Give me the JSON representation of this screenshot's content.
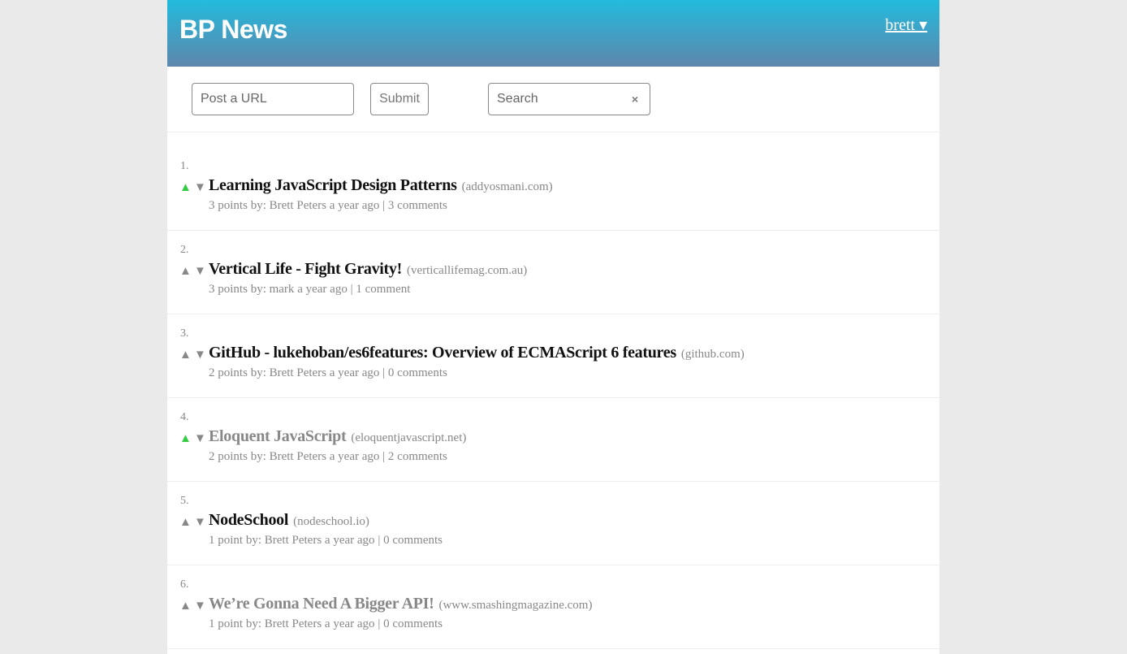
{
  "header": {
    "logo": "BP News",
    "user_label": "brett ▾"
  },
  "toolbar": {
    "url_placeholder": "Post a URL",
    "submit_label": "Submit",
    "search_placeholder": "Search",
    "clear_label": "×"
  },
  "vote_icons": {
    "up": "▲",
    "down": "▼"
  },
  "colors": {
    "header_top": "#22bbdd",
    "header_bottom": "#5e86ac",
    "upvote_active": "#33cc44",
    "muted": "#888888"
  },
  "items": [
    {
      "rank": "1.",
      "title": "Learning JavaScript Design Patterns",
      "domain": "(addyosmani.com)",
      "points": "3 points",
      "by": "by: Brett Peters",
      "time": "a year ago",
      "comments": "3 comments",
      "upvoted": true,
      "visited": false
    },
    {
      "rank": "2.",
      "title": "Vertical Life - Fight Gravity!",
      "domain": "(verticallifemag.com.au)",
      "points": "3 points",
      "by": "by: mark",
      "time": "a year ago",
      "comments": "1 comment",
      "upvoted": false,
      "visited": false
    },
    {
      "rank": "3.",
      "title": "GitHub - lukehoban/es6features: Overview of ECMAScript 6 features",
      "domain": "(github.com)",
      "points": "2 points",
      "by": "by: Brett Peters",
      "time": "a year ago",
      "comments": "0 comments",
      "upvoted": false,
      "visited": false
    },
    {
      "rank": "4.",
      "title": "Eloquent JavaScript",
      "domain": "(eloquentjavascript.net)",
      "points": "2 points",
      "by": "by: Brett Peters",
      "time": "a year ago",
      "comments": "2 comments",
      "upvoted": true,
      "visited": true
    },
    {
      "rank": "5.",
      "title": "NodeSchool",
      "domain": "(nodeschool.io)",
      "points": "1 point",
      "by": "by: Brett Peters",
      "time": "a year ago",
      "comments": "0 comments",
      "upvoted": false,
      "visited": false
    },
    {
      "rank": "6.",
      "title": "We’re Gonna Need A Bigger API!",
      "domain": "(www.smashingmagazine.com)",
      "points": "1 point",
      "by": "by: Brett Peters",
      "time": "a year ago",
      "comments": "0 comments",
      "upvoted": false,
      "visited": true
    }
  ]
}
